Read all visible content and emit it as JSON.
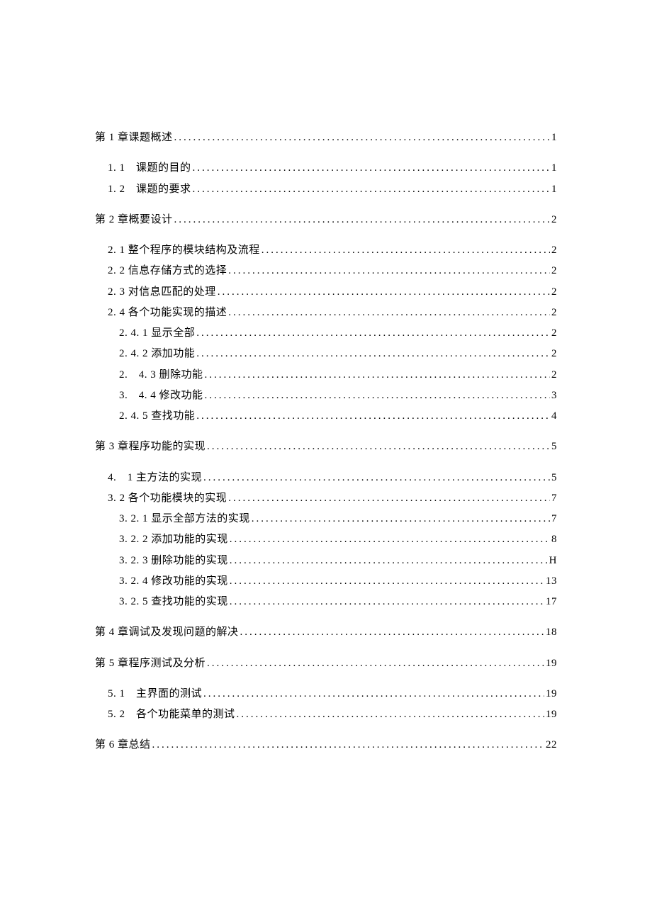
{
  "toc": [
    {
      "label": "第 1 章课题概述",
      "page": "1",
      "level": 1,
      "gapBefore": false
    },
    {
      "label": "1. 1　课题的目的",
      "page": "1",
      "level": 2,
      "gapBefore": true
    },
    {
      "label": "1. 2　课题的要求",
      "page": "1",
      "level": 2,
      "gapBefore": false
    },
    {
      "label": "第 2 章概要设计",
      "page": "2",
      "level": 1,
      "gapBefore": true
    },
    {
      "label": "2. 1 整个程序的模块结构及流程",
      "page": "2",
      "level": 2,
      "gapBefore": true
    },
    {
      "label": "2. 2 信息存储方式的选择",
      "page": "2",
      "level": 2,
      "gapBefore": false
    },
    {
      "label": "2. 3 对信息匹配的处理",
      "page": "2",
      "level": 2,
      "gapBefore": false
    },
    {
      "label": "2. 4 各个功能实现的描述",
      "page": "2",
      "level": 2,
      "gapBefore": false
    },
    {
      "label": "2. 4. 1 显示全部",
      "page": "2",
      "level": 3,
      "gapBefore": false
    },
    {
      "label": "2. 4. 2 添加功能",
      "page": "2",
      "level": 3,
      "gapBefore": false
    },
    {
      "label": "2.　4. 3 删除功能",
      "page": "2",
      "level": 3,
      "gapBefore": false
    },
    {
      "label": "3.　4. 4 修改功能",
      "page": "3",
      "level": 3,
      "gapBefore": false
    },
    {
      "label": "2. 4. 5 查找功能",
      "page": "4",
      "level": 3,
      "gapBefore": false
    },
    {
      "label": "第 3 章程序功能的实现",
      "page": "5",
      "level": 1,
      "gapBefore": true
    },
    {
      "label": "4.　1 主方法的实现",
      "page": "5",
      "level": 2,
      "gapBefore": true
    },
    {
      "label": "3. 2 各个功能模块的实现",
      "page": "7",
      "level": 2,
      "gapBefore": false
    },
    {
      "label": "3. 2. 1 显示全部方法的实现",
      "page": "7",
      "level": 3,
      "gapBefore": false
    },
    {
      "label": "3. 2. 2 添加功能的实现",
      "page": "8",
      "level": 3,
      "gapBefore": false
    },
    {
      "label": "3. 2. 3 删除功能的实现",
      "page": "H",
      "level": 3,
      "gapBefore": false
    },
    {
      "label": "3. 2. 4 修改功能的实现",
      "page": "13",
      "level": 3,
      "gapBefore": false
    },
    {
      "label": "3. 2. 5 查找功能的实现",
      "page": "17",
      "level": 3,
      "gapBefore": false
    },
    {
      "label": "第 4 章调试及发现问题的解决",
      "page": "18",
      "level": 1,
      "gapBefore": true
    },
    {
      "label": "第 5 章程序测试及分析",
      "page": "19",
      "level": 1,
      "gapBefore": true
    },
    {
      "label": "5. 1　主界面的测试",
      "page": "19",
      "level": 2,
      "gapBefore": true
    },
    {
      "label": "5. 2　各个功能菜单的测试",
      "page": "19",
      "level": 2,
      "gapBefore": false
    },
    {
      "label": "第 6 章总结",
      "page": "22",
      "level": 1,
      "gapBefore": true
    }
  ]
}
